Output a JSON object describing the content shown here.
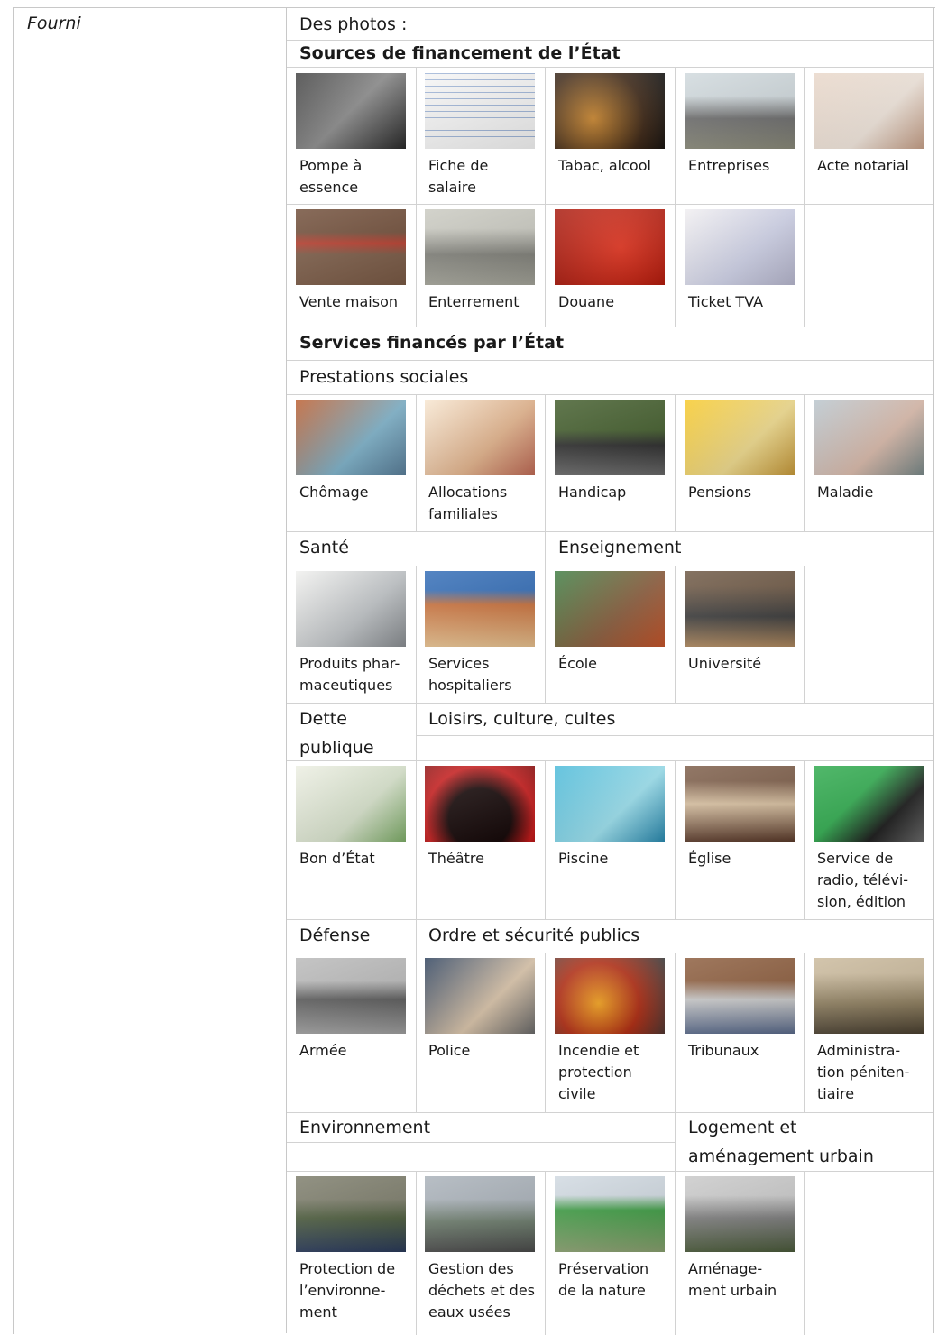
{
  "left_label": "Fourni",
  "intro": "Des photos :",
  "sections": {
    "sources": "Sources de financement de l’État",
    "services": "Services financés par l’État",
    "prestations": "Prestations sociales",
    "sante": "Santé",
    "enseignement": "Enseignement",
    "dette": "Dette\npublique",
    "loisirs": "Loisirs, culture, cultes",
    "defense": "Défense",
    "ordre": "Ordre et sécurité publics",
    "environnement": "Environnement",
    "logement": "Logement et\naménagement urbain"
  },
  "sources_row1": [
    "Pompe à\nessence",
    "Fiche de\nsalaire",
    "Tabac, alcool",
    "Entreprises",
    "Acte notarial"
  ],
  "sources_row2": [
    "Vente maison",
    "Enterrement",
    "Douane",
    "Ticket TVA"
  ],
  "prestations_row": [
    "Chômage",
    "Allocations\nfamiliales",
    "Handicap",
    "Pensions",
    "Maladie"
  ],
  "sante_ens_row": [
    "Produits phar-\nmaceutiques",
    "Services\nhospitaliers",
    "École",
    "Université"
  ],
  "dette_loisirs_row": [
    "Bon d’État",
    "Théâtre",
    "Piscine",
    "Église",
    "Service de\nradio, télévi-\nsion, édition"
  ],
  "defense_ordre_row": [
    "Armée",
    "Police",
    "Incendie et\nprotection\ncivile",
    "Tribunaux",
    "Administra-\ntion péniten-\ntiaire"
  ],
  "env_row": [
    "Protection de\nl’environne-\nment",
    "Gestion des\ndéchets et des\neaux usées",
    "Préservation\nde la nature",
    "Aménage-\nment urbain"
  ],
  "colors": {
    "border": "#c8c8c8",
    "text": "#1a1a1a"
  }
}
